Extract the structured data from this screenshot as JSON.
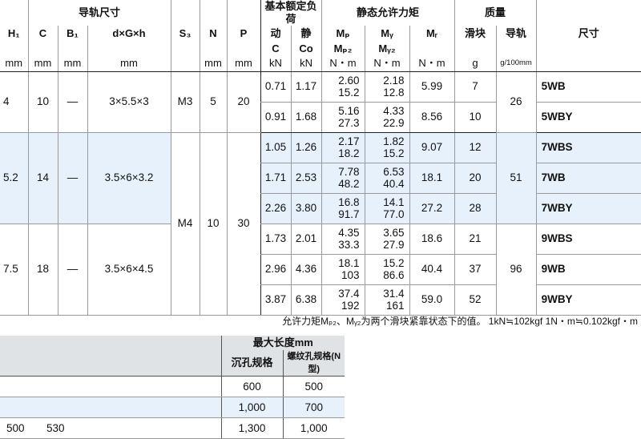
{
  "spec": {
    "groups": {
      "rail_dims": "导轨尺寸",
      "basic_load": "基本额定负荷",
      "static_moment": "静态允许力矩",
      "mass": "质量",
      "size": "尺寸"
    },
    "cols": {
      "H1": "H₁",
      "C": "C",
      "B1": "B₁",
      "dGh": "d×G×h",
      "S3": "S₃",
      "N": "N",
      "P": "P",
      "dyn": "动",
      "stat": "静",
      "Mp": "Mₚ",
      "My": "Mᵧ",
      "Mr": "Mᵣ",
      "slider": "滑块",
      "rail": "导轨",
      "dyn_sym": "C",
      "stat_sym": "Co",
      "Mp2": "Mₚ₂",
      "My2": "Mᵧ₂"
    },
    "units": {
      "mm": "mm",
      "kN": "kN",
      "Nm": "N・m",
      "g": "g",
      "g100": "g/100mm"
    },
    "groups_data": [
      {
        "H1": "4",
        "C": "10",
        "B1": "—",
        "dGh": "3×5.5×3",
        "S3": "M3",
        "N": "5",
        "P": "20",
        "rail": "26",
        "rows": [
          {
            "dyn": "0.71",
            "stat": "1.17",
            "mp1": "2.60",
            "mp2": "15.2",
            "my1": "2.18",
            "my2": "12.8",
            "mr": "5.99",
            "slider": "7",
            "size": "5WB"
          },
          {
            "dyn": "0.91",
            "stat": "1.68",
            "mp1": "5.16",
            "mp2": "27.3",
            "my1": "4.33",
            "my2": "22.9",
            "mr": "8.56",
            "slider": "10",
            "size": "5WBY"
          }
        ]
      },
      {
        "H1": "5.2",
        "C": "14",
        "B1": "—",
        "dGh": "3.5×6×3.2",
        "rail": "51",
        "rows": [
          {
            "dyn": "1.05",
            "stat": "1.26",
            "mp1": "2.17",
            "mp2": "18.2",
            "my1": "1.82",
            "my2": "15.2",
            "mr": "9.07",
            "slider": "12",
            "size": "7WBS"
          },
          {
            "dyn": "1.71",
            "stat": "2.53",
            "mp1": "7.78",
            "mp2": "48.2",
            "my1": "6.53",
            "my2": "40.4",
            "mr": "18.1",
            "slider": "20",
            "size": "7WB"
          },
          {
            "dyn": "2.26",
            "stat": "3.80",
            "mp1": "16.8",
            "mp2": "91.7",
            "my1": "14.1",
            "my2": "77.0",
            "mr": "27.2",
            "slider": "28",
            "size": "7WBY"
          }
        ]
      },
      {
        "H1": "7.5",
        "C": "18",
        "B1": "—",
        "dGh": "3.5×6×4.5",
        "rail": "96",
        "rows": [
          {
            "dyn": "1.73",
            "stat": "2.01",
            "mp1": "4.35",
            "mp2": "33.3",
            "my1": "3.65",
            "my2": "27.9",
            "mr": "18.6",
            "slider": "21",
            "size": "9WBS"
          },
          {
            "dyn": "2.96",
            "stat": "4.36",
            "mp1": "18.1",
            "mp2": "103",
            "my1": "15.2",
            "my2": "86.6",
            "mr": "40.4",
            "slider": "37",
            "size": "9WB"
          },
          {
            "dyn": "3.87",
            "stat": "6.38",
            "mp1": "37.4",
            "mp2": "192",
            "my1": "31.4",
            "my2": "161",
            "mr": "59.0",
            "slider": "52",
            "size": "9WBY"
          }
        ]
      }
    ],
    "shared": {
      "S3": "M4",
      "N": "10",
      "P": "30"
    }
  },
  "footnote": "允许力矩Mₚ₂、Mᵧ₂为两个滑块紧靠状态下的值。 1kN≒102kgf 1N・m≒0.102kgf・m",
  "length": {
    "title": "最大长度mm",
    "col1": "沉孔规格",
    "col2": "螺纹孔规格(N型)",
    "rows": [
      {
        "a": "",
        "b": "",
        "c1": "600",
        "c2": "500"
      },
      {
        "a": "",
        "b": "",
        "c1": "1,000",
        "c2": "700"
      },
      {
        "a": "500",
        "b": "530",
        "c1": "1,300",
        "c2": "1,000"
      }
    ]
  }
}
